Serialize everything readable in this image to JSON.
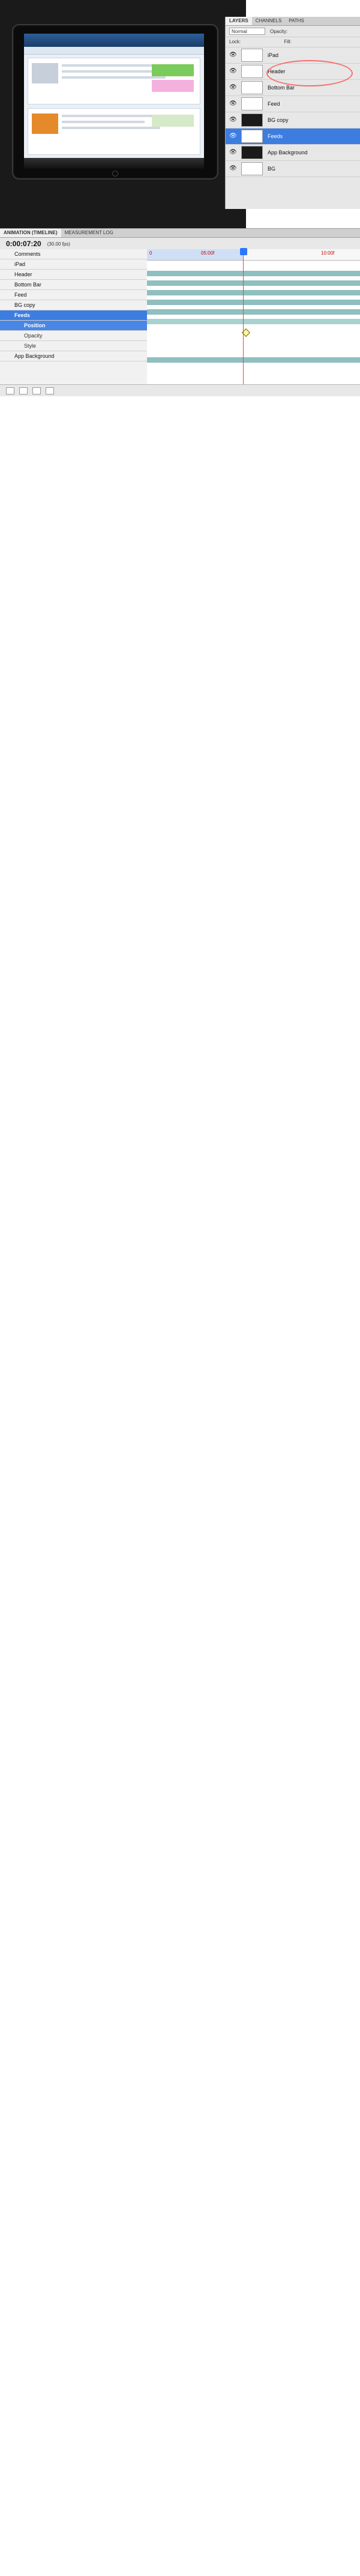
{
  "layers_panel": {
    "tabs": [
      "LAYERS",
      "CHANNELS",
      "PATHS"
    ],
    "blend_mode": "Normal",
    "opacity_label": "Opacity:",
    "fill_label": "Fill:",
    "lock_label": "Lock:",
    "layers": [
      "iPad",
      "Header",
      "Bottom Bar",
      "Feed",
      "BG copy",
      "Feeds",
      "App Background",
      "BG"
    ]
  },
  "timeline": {
    "tabs": [
      "ANIMATION (TIMELINE)",
      "MEASUREMENT LOG"
    ],
    "timecode": "0:00:07:20",
    "fps": "(30.00 fps)",
    "ruler_marks": [
      "0",
      "05:00f",
      "10:00f"
    ],
    "rows": [
      "Comments",
      "iPad",
      "Header",
      "Bottom Bar",
      "Feed",
      "BG copy",
      "Feeds",
      "Position",
      "Opacity",
      "Style",
      "App Background"
    ]
  }
}
